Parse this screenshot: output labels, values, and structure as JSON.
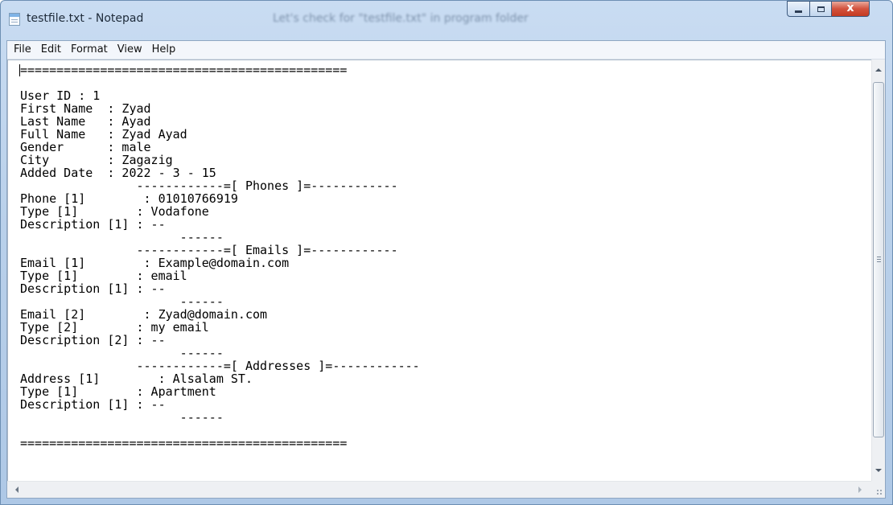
{
  "window": {
    "title": "testfile.txt - Notepad",
    "ghost_title": "Let's check for \"testfile.txt\" in program folder",
    "close_symbol": "x",
    "accent": "#c43b22"
  },
  "menu": [
    "File",
    "Edit",
    "Format",
    "View",
    "Help"
  ],
  "editor": {
    "lines": [
      "=============================================",
      "",
      "User ID : 1",
      "First Name  : Zyad",
      "Last Name   : Ayad",
      "Full Name   : Zyad Ayad",
      "Gender      : male",
      "City        : Zagazig",
      "Added Date  : 2022 - 3 - 15",
      "                ------------=[ Phones ]=------------",
      "Phone [1]        : 01010766919",
      "Type [1]        : Vodafone",
      "Description [1] : --",
      "                      ------",
      "                ------------=[ Emails ]=------------",
      "Email [1]        : Example@domain.com",
      "Type [1]        : email",
      "Description [1] : --",
      "                      ------",
      "Email [2]        : Zyad@domain.com",
      "Type [2]        : my email",
      "Description [2] : --",
      "                      ------",
      "                ------------=[ Addresses ]=------------",
      "Address [1]        : Alsalam ST.",
      "Type [1]        : Apartment",
      "Description [1] : --",
      "                      ------",
      "",
      "============================================="
    ]
  },
  "scrollbars": {
    "vertical_icons": [
      "up-arrow-icon",
      "down-arrow-icon"
    ],
    "horizontal_icons": [
      "left-arrow-icon",
      "right-arrow-icon"
    ]
  }
}
